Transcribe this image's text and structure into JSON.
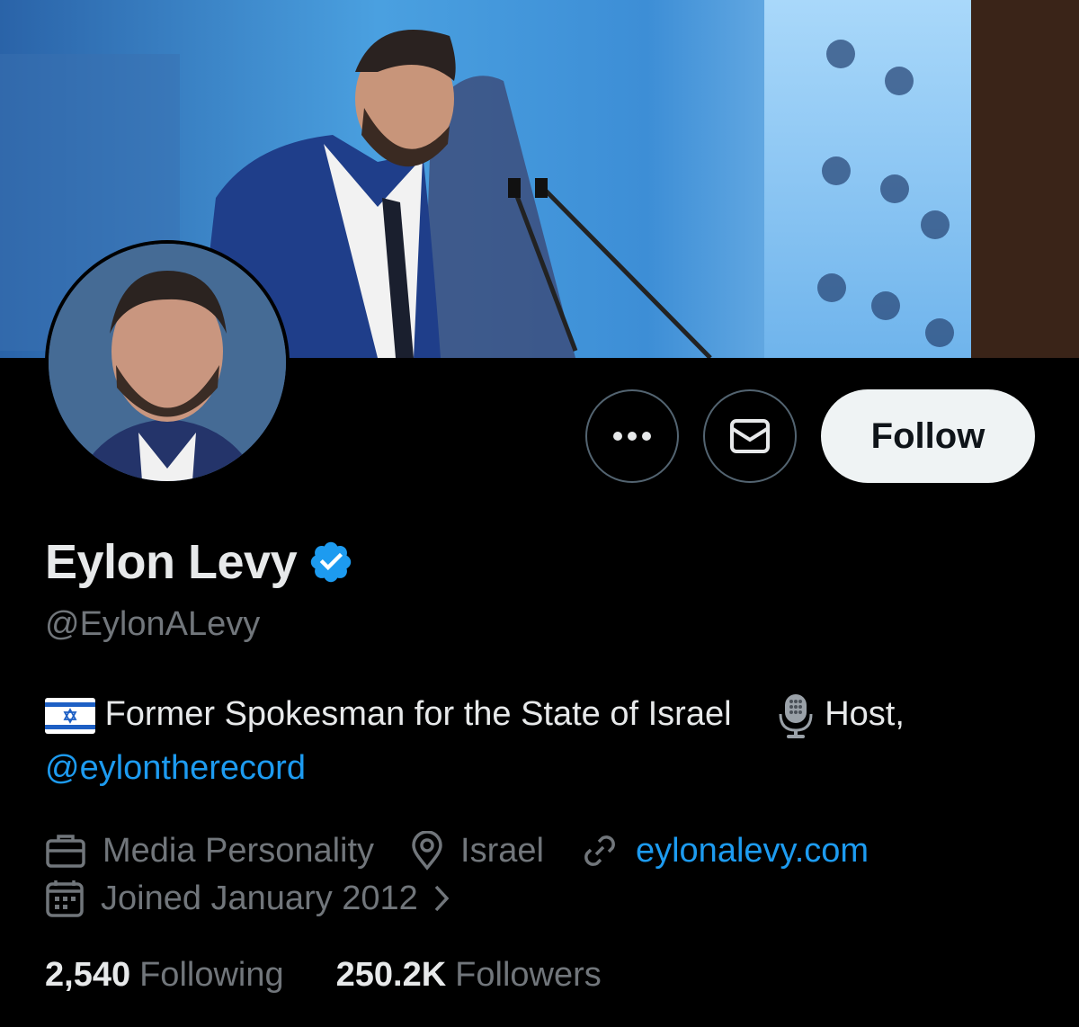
{
  "profile": {
    "display_name": "Eylon Levy",
    "handle": "@EylonALevy",
    "verified": true,
    "bio": {
      "flag_icon": "israel-flag-emoji",
      "text_main": "Former Spokesman for the State of Israel",
      "mic_icon": "microphone-emoji",
      "text_host": "Host,",
      "mention": "@eylontherecord"
    },
    "meta": {
      "category": "Media Personality",
      "location": "Israel",
      "website": "eylonalevy.com",
      "joined": "Joined January 2012"
    },
    "stats": {
      "following_count": "2,540",
      "following_label": "Following",
      "followers_count": "250.2K",
      "followers_label": "Followers"
    }
  },
  "actions": {
    "more_label": "•••",
    "follow_label": "Follow"
  },
  "colors": {
    "background": "#000000",
    "text_primary": "#e7e9ea",
    "text_secondary": "#71767b",
    "accent": "#1d9bf0",
    "follow_button_bg": "#eff3f4"
  }
}
